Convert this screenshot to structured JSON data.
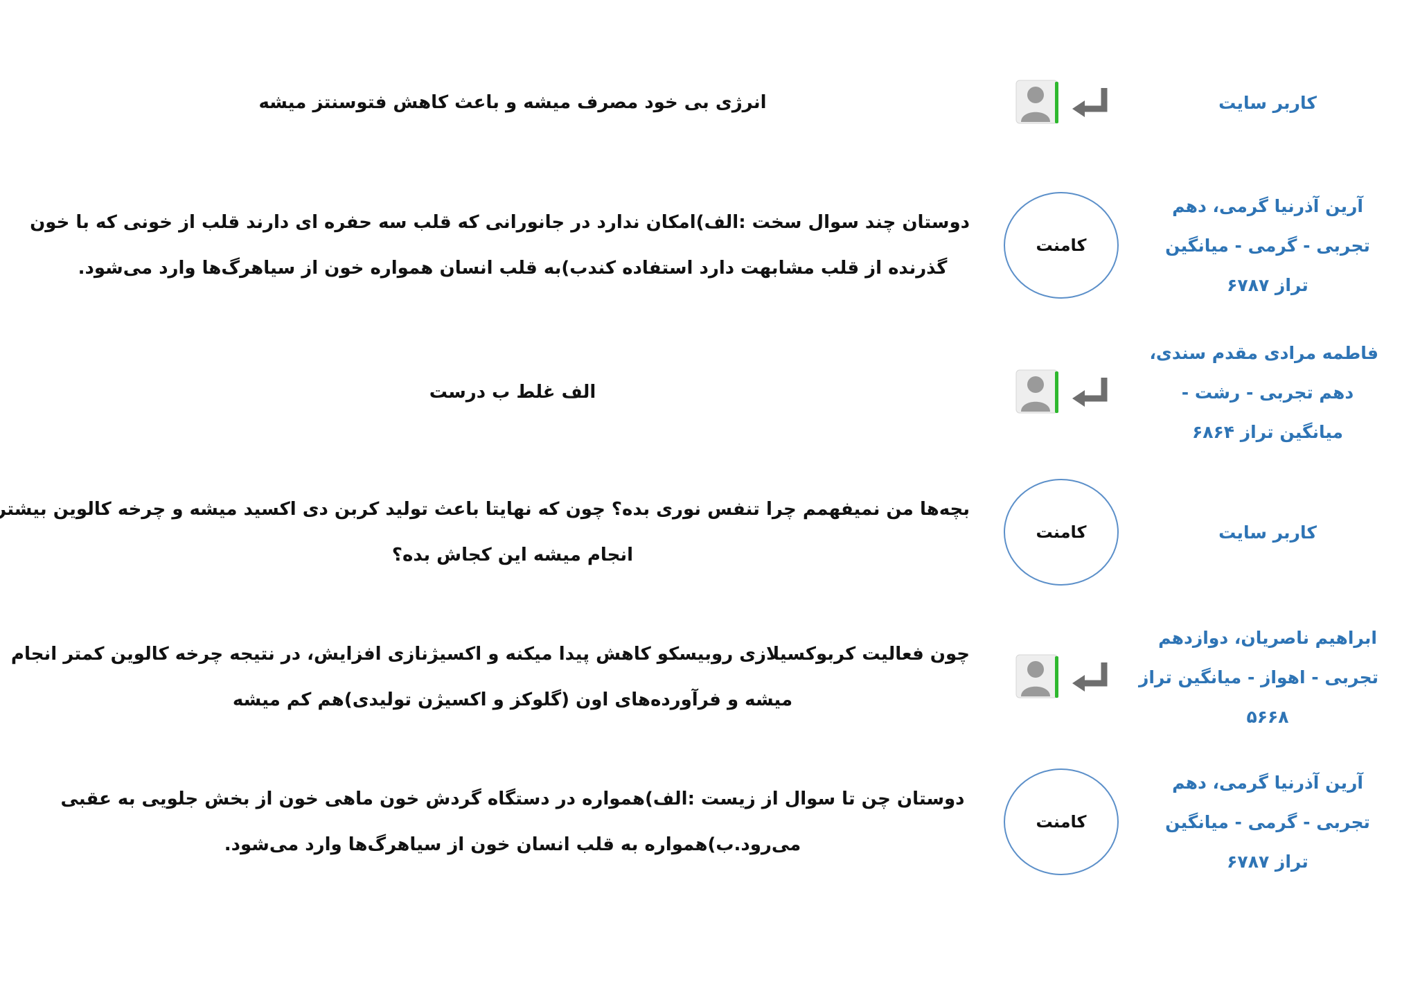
{
  "badge_label": "کامنت",
  "colors": {
    "author": "#2e74b5",
    "text": "#111111",
    "badge_border": "#5b8fc9",
    "reply_arrow": "#6e6e6e",
    "avatar": "#9a9a9a",
    "avatar_accent": "#2eb82e"
  },
  "icons": {
    "reply": "reply-arrow-icon",
    "avatar": "user-avatar-icon"
  },
  "comments": [
    {
      "kind": "reply",
      "author_lines": [
        "کاربر سایت"
      ],
      "text_lines": [
        "انرژی بی خود مصرف میشه و باعث کاهش فتوسنتز میشه"
      ]
    },
    {
      "kind": "comment",
      "author_lines": [
        "آرین آذرنیا گرمی، دهم",
        "تجربی - گرمی - میانگین",
        "تراز ۶۷۸۷"
      ],
      "text_lines": [
        "دوستان چند سوال سخت :الف)امکان ندارد در جانورانی که قلب سه حفره ای دارند قلب از خونی که با خون",
        "گذرنده از قلب مشابهت دارد استفاده کندب)به قلب انسان همواره خون از سیاهرگ‌ها وارد می‌شود."
      ]
    },
    {
      "kind": "reply",
      "author_lines": [
        "فاطمه مرادی مقدم سندی،",
        "دهم تجربی - رشت -",
        "میانگین تراز ۶۸۶۴"
      ],
      "text_lines": [
        "الف غلط ب درست"
      ]
    },
    {
      "kind": "comment",
      "author_lines": [
        "کاربر سایت"
      ],
      "text_lines": [
        "بچه‌ها من نمیفهمم چرا تنفس نوری بده؟ چون که نهایتا باعث تولید کربن دی اکسید میشه و چرخه کالوین بیشتر",
        "انجام میشه این کجاش بده؟"
      ]
    },
    {
      "kind": "reply",
      "author_lines": [
        "ابراهیم ناصریان، دوازدهم",
        "تجربی - اهواز - میانگین تراز",
        "۵۶۶۸"
      ],
      "text_lines": [
        "چون فعالیت کربوکسیلازی روبیسکو کاهش پیدا میکنه و اکسیژنازی افزایش، در نتیجه چرخه کالوین کمتر انجام",
        "میشه و فرآورده‌های اون (گلوکز و اکسیژن تولیدی)هم کم میشه"
      ]
    },
    {
      "kind": "comment",
      "author_lines": [
        "آرین آذرنیا گرمی، دهم",
        "تجربی - گرمی - میانگین",
        "تراز ۶۷۸۷"
      ],
      "text_lines": [
        "دوستان چن تا سوال از زیست :الف)همواره در دستگاه گردش خون ماهی خون از بخش جلویی به عقبی",
        "می‌رود.ب)همواره به قلب انسان خون از سیاهرگ‌ها وارد می‌شود."
      ]
    }
  ]
}
